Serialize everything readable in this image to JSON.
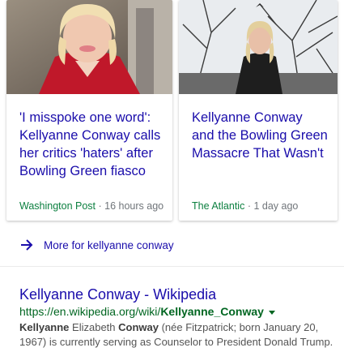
{
  "cards": [
    {
      "headline": "'I misspoke one word': Kellyanne Conway calls her critics 'haters' after Bowling Green fiasco",
      "publisher": "Washington Post",
      "age": "16 hours ago"
    },
    {
      "headline": "Kellyanne Conway and the Bowling Green Massacre That Wasn't",
      "publisher": "The Atlantic",
      "age": "1 day ago"
    }
  ],
  "more_link": {
    "label": "More for kellyanne conway",
    "icon": "arrow-right-icon"
  },
  "result": {
    "title": "Kellyanne Conway - Wikipedia",
    "url_prefix": "https://en.wikipedia.org/wiki/",
    "url_bold": "Kellyanne_Conway",
    "snippet_bold1": "Kellyanne",
    "snippet_text1": " Elizabeth ",
    "snippet_bold2": "Conway",
    "snippet_text2": " (née Fitzpatrick; born January 20, 1967) is currently serving as Counselor to President Donald Trump."
  },
  "colors": {
    "link": "#1a0dab",
    "url": "#006621",
    "source": "#0b7f3f"
  }
}
